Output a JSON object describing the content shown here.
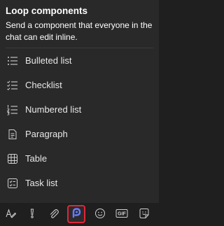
{
  "header": {
    "title": "Loop components",
    "description": "Send a component that everyone in the chat can edit inline."
  },
  "items": [
    {
      "label": "Bulleted list",
      "icon": "bulleted-list-icon"
    },
    {
      "label": "Checklist",
      "icon": "checklist-icon"
    },
    {
      "label": "Numbered list",
      "icon": "numbered-list-icon"
    },
    {
      "label": "Paragraph",
      "icon": "paragraph-icon"
    },
    {
      "label": "Table",
      "icon": "table-icon"
    },
    {
      "label": "Task list",
      "icon": "task-list-icon"
    }
  ],
  "toolbar": {
    "buttons": [
      {
        "icon": "format-icon"
      },
      {
        "icon": "important-icon"
      },
      {
        "icon": "attach-icon"
      },
      {
        "icon": "loop-icon",
        "active": true
      },
      {
        "icon": "emoji-icon"
      },
      {
        "icon": "gif-icon",
        "text": "GIF"
      },
      {
        "icon": "sticker-icon"
      }
    ]
  },
  "colors": {
    "panel_bg": "#292929",
    "toolbar_bg": "#1f1f1f",
    "active_outline": "#e0263a",
    "loop_accent": "#6a7cff"
  }
}
